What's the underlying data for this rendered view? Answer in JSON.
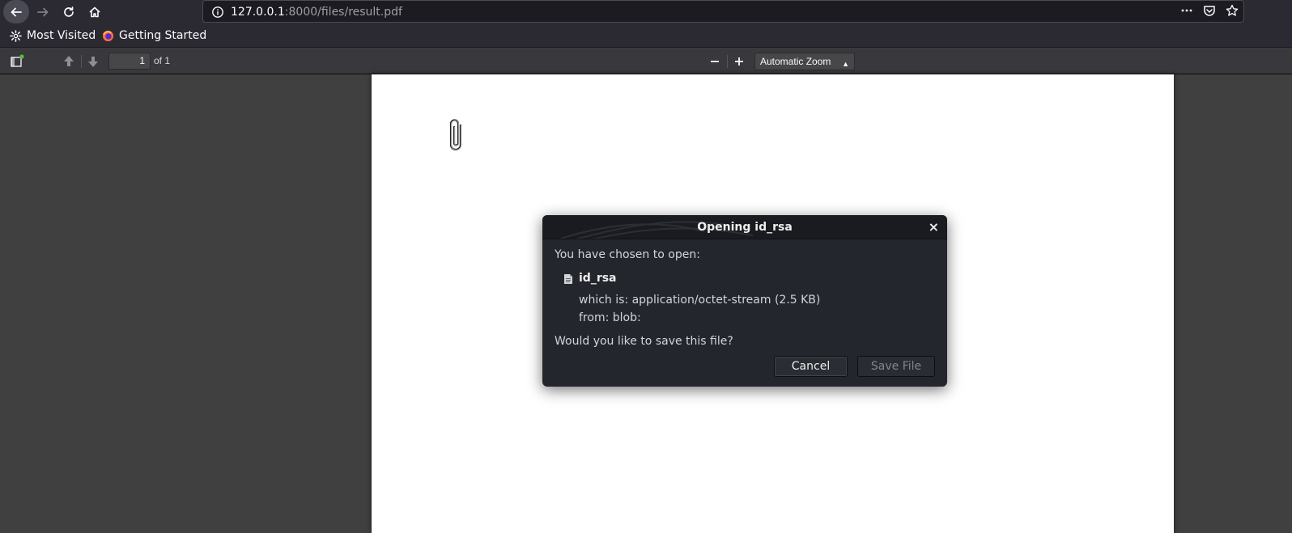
{
  "browser": {
    "url_host": "127.0.0.1",
    "url_rest": ":8000/files/result.pdf",
    "icons": [
      "back-icon",
      "forward-icon",
      "reload-icon",
      "home-icon",
      "info-icon",
      "more-icon",
      "pocket-icon",
      "star-icon"
    ]
  },
  "bookmarks": {
    "items": [
      {
        "label": "Most Visited",
        "icon": "gear-icon"
      },
      {
        "label": "Getting Started",
        "icon": "firefox-icon"
      }
    ]
  },
  "pdf_toolbar": {
    "page_number": "1",
    "page_total": "of 1",
    "zoom_minus": "—",
    "zoom_plus": "+",
    "zoom_value": "Automatic Zoom"
  },
  "dialog": {
    "title": "Opening id_rsa",
    "close": "×",
    "intro": "You have chosen to open:",
    "filename": "id_rsa",
    "which_is_label": "which is:",
    "which_is_value": "application/octet-stream (2.5 KB)",
    "from_label": "from:",
    "from_value": "blob:",
    "question": "Would you like to save this file?",
    "cancel_label": "Cancel",
    "save_label": "Save File"
  },
  "colors": {
    "viewer_bg": "#404040",
    "dialog_bg": "#24262d",
    "toolbar_bg": "#38383d"
  }
}
